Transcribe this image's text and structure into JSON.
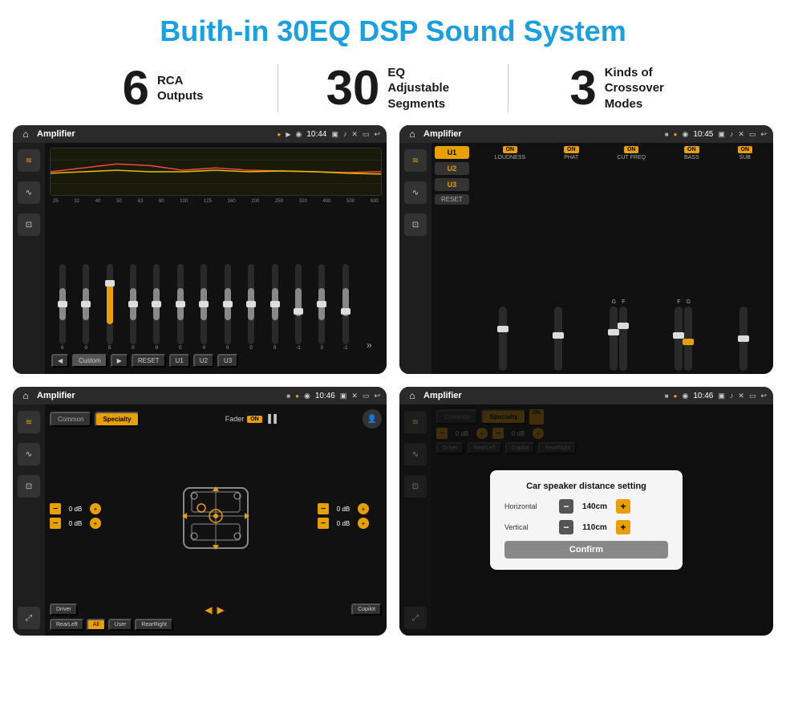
{
  "page": {
    "title": "Buith-in 30EQ DSP Sound System"
  },
  "stats": [
    {
      "number": "6",
      "desc": "RCA\nOutputs"
    },
    {
      "number": "30",
      "desc": "EQ Adjustable\nSegments"
    },
    {
      "number": "3",
      "desc": "Kinds of\nCrossover Modes"
    }
  ],
  "screens": [
    {
      "id": "eq-screen",
      "status": {
        "app": "Amplifier",
        "time": "10:44"
      },
      "eq_freqs": [
        "25",
        "32",
        "40",
        "50",
        "63",
        "80",
        "100",
        "125",
        "160",
        "200",
        "250",
        "320",
        "400",
        "500",
        "630"
      ],
      "eq_vals": [
        "0",
        "0",
        "0",
        "5",
        "0",
        "0",
        "0",
        "0",
        "0",
        "0",
        "0",
        "-1",
        "0",
        "-1"
      ],
      "eq_preset": "Custom",
      "eq_buttons": [
        "RESET",
        "U1",
        "U2",
        "U3"
      ]
    },
    {
      "id": "amp2-screen",
      "status": {
        "app": "Amplifier",
        "time": "10:45"
      },
      "presets": [
        "U1",
        "U2",
        "U3"
      ],
      "controls": [
        {
          "label": "LOUDNESS",
          "on": true
        },
        {
          "label": "PHAT",
          "on": true
        },
        {
          "label": "CUT FREQ",
          "on": true
        },
        {
          "label": "BASS",
          "on": true
        },
        {
          "label": "SUB",
          "on": true
        }
      ],
      "reset": "RESET"
    },
    {
      "id": "fader-screen",
      "status": {
        "app": "Amplifier",
        "time": "10:46"
      },
      "tabs": [
        "Common",
        "Specialty"
      ],
      "fader": "Fader",
      "fader_on": "ON",
      "channels": [
        {
          "label": "",
          "val": "0 dB"
        },
        {
          "label": "",
          "val": "0 dB"
        },
        {
          "label": "",
          "val": "0 dB"
        },
        {
          "label": "",
          "val": "0 dB"
        }
      ],
      "buttons": {
        "driver": "Driver",
        "rearLeft": "RearLeft",
        "all": "All",
        "user": "User",
        "rearRight": "RearRight",
        "copilot": "Copilot"
      }
    },
    {
      "id": "dialog-screen",
      "status": {
        "app": "Amplifier",
        "time": "10:46"
      },
      "tabs": [
        "Common",
        "Specialty"
      ],
      "dialog": {
        "title": "Car speaker distance setting",
        "horizontal_label": "Horizontal",
        "horizontal_val": "140cm",
        "vertical_label": "Vertical",
        "vertical_val": "110cm",
        "confirm": "Confirm"
      },
      "buttons": {
        "driver": "Driver",
        "rearLeft": "RearLeft",
        "copilot": "Copilot",
        "rearRight": "RearRight"
      },
      "right_vals": [
        "0 dB",
        "0 dB"
      ]
    }
  ],
  "icons": {
    "home": "⌂",
    "location": "◉",
    "camera": "📷",
    "volume": "🔊",
    "back": "↩",
    "menu": "☰",
    "eq": "≋",
    "wave": "∿",
    "speaker": "⊡",
    "expand": "⤢",
    "user": "👤",
    "arrow_left": "◀",
    "arrow_right": "▶",
    "arrow_up": "▲",
    "arrow_down": "▼",
    "minus": "−",
    "plus": "+"
  }
}
